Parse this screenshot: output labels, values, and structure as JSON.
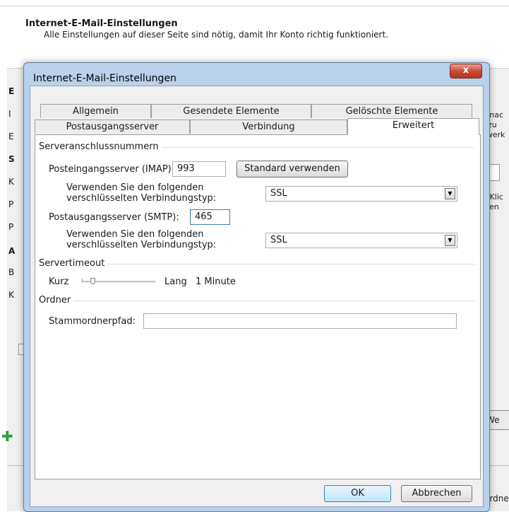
{
  "background": {
    "title": "Internet-E-Mail-Einstellungen",
    "subtitle": "Alle Einstellungen auf dieser Seite sind nötig, damit Ihr Konto richtig funktioniert.",
    "left_letters": [
      "E",
      "I",
      "E",
      "S",
      "K",
      "P",
      "P",
      "A",
      "B",
      "K"
    ],
    "right_snippets": [
      "o nac",
      "r zu",
      "zwerk",
      "h Klic",
      "sten"
    ],
    "right_button": "We",
    "bottom_text": "Ordne"
  },
  "dialog": {
    "title": "Internet-E-Mail-Einstellungen",
    "close_label": "x",
    "tabs_row1": [
      "Allgemein",
      "Gesendete Elemente",
      "Gelöschte Elemente"
    ],
    "tabs_row2": [
      "Postausgangsserver",
      "Verbindung",
      "Erweitert"
    ],
    "active_tab": "Erweitert",
    "server_ports": {
      "group_label": "Serveranschlussnummern",
      "incoming_label": "Posteingangsserver (IMAP):",
      "incoming_value": "993",
      "default_button": "Standard verwenden",
      "encryption_label_line1": "Verwenden Sie den folgenden",
      "encryption_label_line2": "verschlüsselten Verbindungstyp:",
      "incoming_encryption": "SSL",
      "outgoing_label": "Postausgangsserver (SMTP):",
      "outgoing_value": "465",
      "outgoing_encryption": "SSL"
    },
    "timeout": {
      "group_label": "Servertimeout",
      "short_label": "Kurz",
      "long_label": "Lang",
      "value_label": "1 Minute",
      "slider_position": 0.12
    },
    "folders": {
      "group_label": "Ordner",
      "root_label": "Stammordnerpfad:",
      "root_value": ""
    },
    "ok_label": "OK",
    "cancel_label": "Abbrechen"
  }
}
